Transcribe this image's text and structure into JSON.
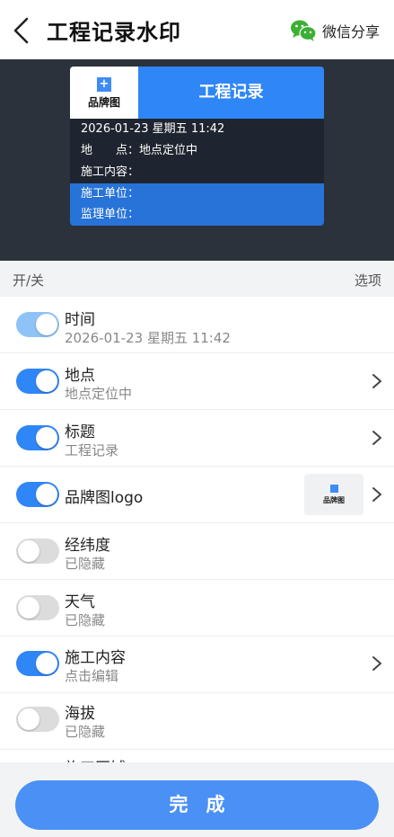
{
  "header": {
    "title": "工程记录水印",
    "share_label": "微信分享"
  },
  "watermark": {
    "logo_text": "品牌图",
    "title": "工程记录",
    "datetime": "2026-01-23 星期五 11:42",
    "location": "地　　点：地点定位中",
    "content": "施工内容：",
    "unit": "施工单位：",
    "supervisor": "监理单位："
  },
  "list_header": {
    "left": "开/关",
    "right": "选项"
  },
  "options": [
    {
      "title": "时间",
      "sub": "2026-01-23 星期五 11:42",
      "state": "on-disabled",
      "chevron": false
    },
    {
      "title": "地点",
      "sub": "地点定位中",
      "state": "on",
      "chevron": true
    },
    {
      "title": "标题",
      "sub": "工程记录",
      "state": "on",
      "chevron": true
    },
    {
      "title": "品牌图logo",
      "sub": "",
      "state": "on",
      "chevron": true,
      "thumb_text": "品牌图"
    },
    {
      "title": "经纬度",
      "sub": "已隐藏",
      "state": "off",
      "chevron": false
    },
    {
      "title": "天气",
      "sub": "已隐藏",
      "state": "off",
      "chevron": false
    },
    {
      "title": "施工内容",
      "sub": "点击编辑",
      "state": "on",
      "chevron": true
    },
    {
      "title": "海拔",
      "sub": "已隐藏",
      "state": "off",
      "chevron": false
    },
    {
      "title": "施工区域",
      "sub": "",
      "state": "off",
      "chevron": false
    }
  ],
  "done_label": "完成",
  "colors": {
    "accent": "#2f86f6",
    "toggle_disabled": "#8fc3f8",
    "done_button": "#4a90f5",
    "preview_bg": "#2b323c",
    "wechat_green": "#3cb034"
  },
  "icons": {
    "back": "back-arrow-icon",
    "share": "wechat-icon",
    "chevron": "chevron-right-icon"
  }
}
